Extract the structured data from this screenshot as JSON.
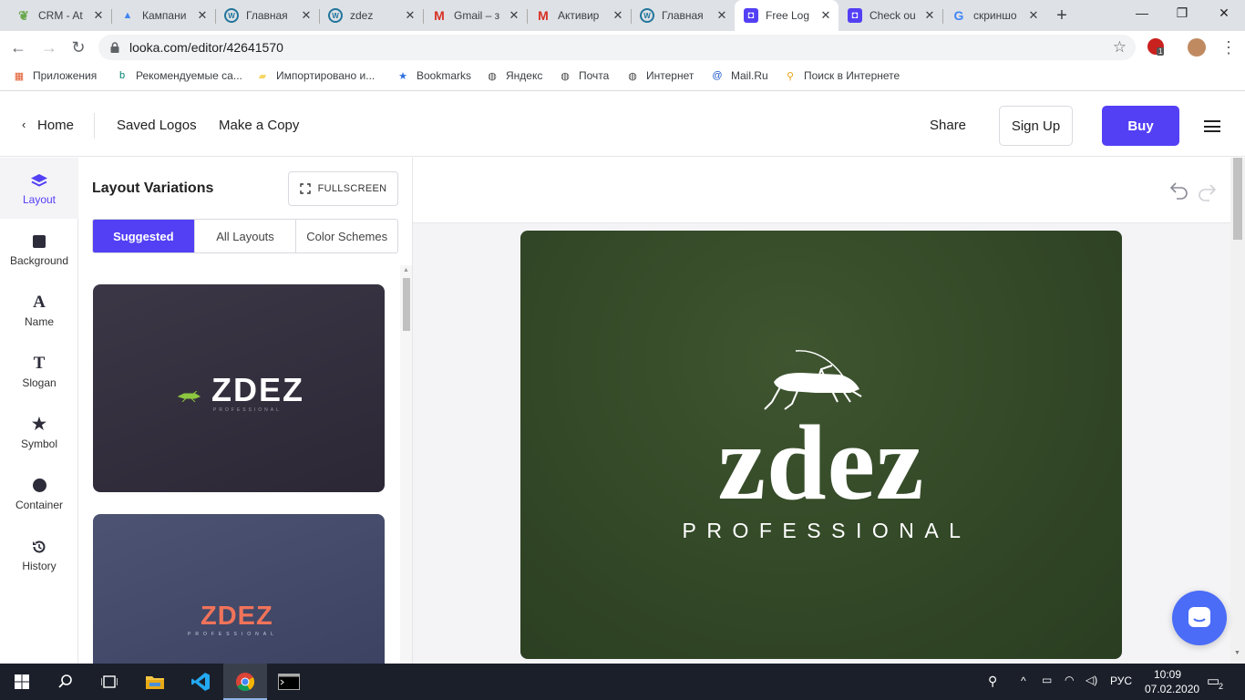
{
  "browser": {
    "tabs": [
      {
        "title": "CRM - At",
        "icon": "leaf-icon",
        "color": "#6aa84f"
      },
      {
        "title": "Кампани",
        "icon": "google-ads-icon",
        "color": "#4285f4"
      },
      {
        "title": "Главная",
        "icon": "wordpress-icon",
        "color": "#21759b"
      },
      {
        "title": "zdez",
        "icon": "wordpress-icon",
        "color": "#21759b"
      },
      {
        "title": "Gmail – з",
        "icon": "gmail-icon",
        "color": "#d93025"
      },
      {
        "title": "Активир",
        "icon": "gmail-icon",
        "color": "#d93025"
      },
      {
        "title": "Главная",
        "icon": "wordpress-icon",
        "color": "#21759b"
      },
      {
        "title": "Free Log",
        "icon": "looka-icon",
        "color": "#5340f5",
        "active": true
      },
      {
        "title": "Check ou",
        "icon": "looka-icon",
        "color": "#5340f5"
      },
      {
        "title": "скриншо",
        "icon": "google-icon",
        "color": "#4285f4"
      }
    ],
    "url": "looka.com/editor/42641570",
    "bookmarks": [
      {
        "label": "Приложения",
        "icon": "apps-grid-icon"
      },
      {
        "label": "Рекомендуемые са...",
        "icon": "bing-icon"
      },
      {
        "label": "Импортировано и...",
        "icon": "folder-icon"
      },
      {
        "label": "Bookmarks",
        "icon": "star-icon"
      },
      {
        "label": "Яндекс",
        "icon": "globe-icon"
      },
      {
        "label": "Почта",
        "icon": "globe-icon"
      },
      {
        "label": "Интернет",
        "icon": "globe-icon"
      },
      {
        "label": "Mail.Ru",
        "icon": "mailru-icon"
      },
      {
        "label": "Поиск в Интернете",
        "icon": "search-globe-icon"
      }
    ],
    "extension_badge": "1"
  },
  "header": {
    "home": "Home",
    "saved_logos": "Saved Logos",
    "make_copy": "Make a Copy",
    "share": "Share",
    "sign_up": "Sign Up",
    "buy": "Buy"
  },
  "rail": {
    "items": [
      {
        "label": "Layout",
        "icon": "layers-icon"
      },
      {
        "label": "Background",
        "icon": "square-icon"
      },
      {
        "label": "Name",
        "icon": "letter-a-icon"
      },
      {
        "label": "Slogan",
        "icon": "letter-t-icon"
      },
      {
        "label": "Symbol",
        "icon": "star-icon"
      },
      {
        "label": "Container",
        "icon": "circle-icon"
      },
      {
        "label": "History",
        "icon": "history-icon"
      }
    ],
    "glyphs": {
      "name": "A",
      "slogan": "T",
      "symbol": "★"
    }
  },
  "panel": {
    "title": "Layout Variations",
    "fullscreen": "FULLSCREEN",
    "tabs": [
      "Suggested",
      "All Layouts",
      "Color Schemes"
    ],
    "cards": [
      {
        "name": "ZDEZ",
        "slogan": "PROFESSIONAL",
        "bg_from": "#3b3746",
        "bg_to": "#2c2735",
        "name_color": "#ffffff",
        "symbol_color": "#8dc63f"
      },
      {
        "name": "ZDEZ",
        "slogan": "PROFESSIONAL",
        "bg_from": "#4c5373",
        "bg_to": "#3a4060",
        "name_color": "#f0735a",
        "symbol_color": "#f0735a"
      }
    ]
  },
  "canvas": {
    "name": "zdez",
    "slogan": "PROFESSIONAL",
    "background": "#344a28",
    "text_color": "#ffffff"
  },
  "taskbar": {
    "lang": "РУС",
    "time": "10:09",
    "date": "07.02.2020",
    "notifications": "2"
  }
}
